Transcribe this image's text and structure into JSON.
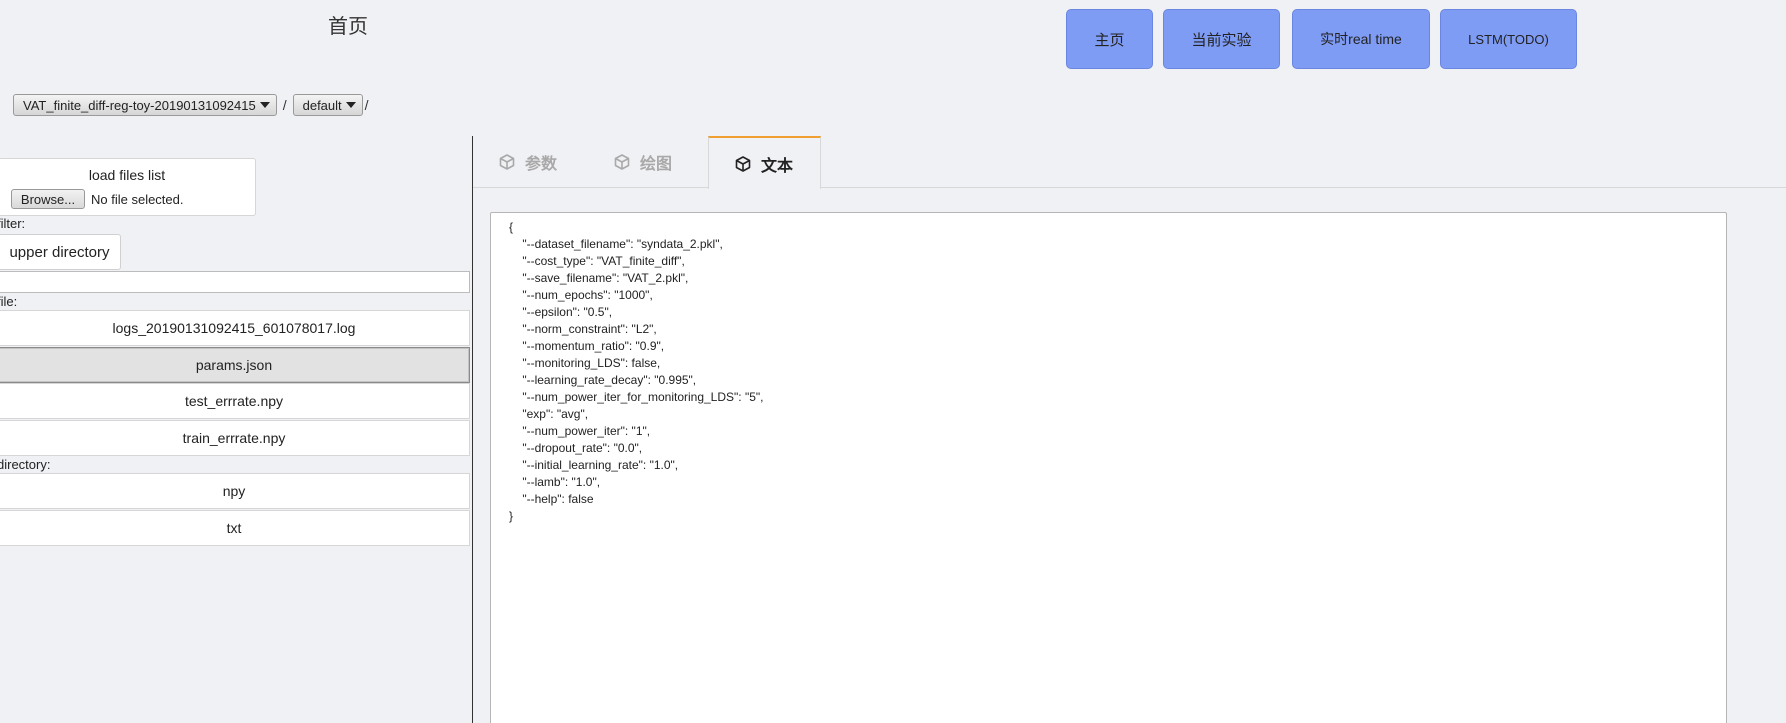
{
  "header": {
    "title": "首页"
  },
  "nav": {
    "home": "主页",
    "current_experiment": "当前实验",
    "realtime": "实时real time",
    "lstm": "LSTM(TODO)"
  },
  "breadcrumb": {
    "experiment": "VAT_finite_diff-reg-toy-20190131092415",
    "subfolder": "default",
    "separator": "/"
  },
  "left": {
    "load_title": "load files list",
    "browse_label": "Browse...",
    "no_file": "No file selected.",
    "filter_label": "filter:",
    "upper_directory": "upper directory",
    "file_label": "file:",
    "files": [
      "logs_20190131092415_601078017.log",
      "params.json",
      "test_errrate.npy",
      "train_errrate.npy"
    ],
    "directory_label": "directory:",
    "directories": [
      "npy",
      "txt"
    ]
  },
  "tabs": {
    "params": "参数",
    "plot": "绘图",
    "text": "文本"
  },
  "text_content": "{\n    \"--dataset_filename\": \"syndata_2.pkl\",\n    \"--cost_type\": \"VAT_finite_diff\",\n    \"--save_filename\": \"VAT_2.pkl\",\n    \"--num_epochs\": \"1000\",\n    \"--epsilon\": \"0.5\",\n    \"--norm_constraint\": \"L2\",\n    \"--momentum_ratio\": \"0.9\",\n    \"--monitoring_LDS\": false,\n    \"--learning_rate_decay\": \"0.995\",\n    \"--num_power_iter_for_monitoring_LDS\": \"5\",\n    \"exp\": \"avg\",\n    \"--num_power_iter\": \"1\",\n    \"--dropout_rate\": \"0.0\",\n    \"--initial_learning_rate\": \"1.0\",\n    \"--lamb\": \"1.0\",\n    \"--help\": false\n}",
  "colors": {
    "nav_button": "#7f9cf5",
    "active_tab_accent": "#f0a030"
  }
}
